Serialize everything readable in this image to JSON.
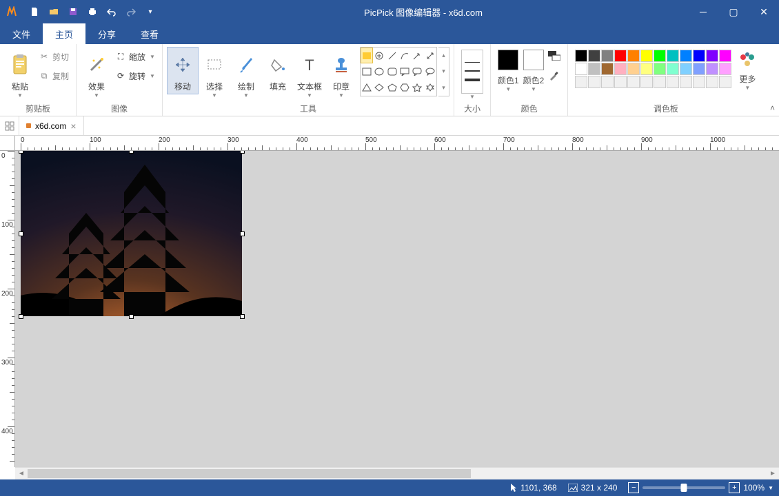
{
  "app": {
    "title": "PicPick 图像编辑器 - x6d.com"
  },
  "menu": {
    "file": "文件",
    "home": "主页",
    "share": "分享",
    "view": "查看"
  },
  "ribbon": {
    "clipboard": {
      "paste": "粘贴",
      "cut": "剪切",
      "copy": "复制",
      "label": "剪贴板"
    },
    "image": {
      "effects": "效果",
      "zoom": "缩放",
      "rotate": "旋转",
      "label": "图像"
    },
    "tools": {
      "move": "移动",
      "select": "选择",
      "draw": "绘制",
      "fill": "填充",
      "text": "文本框",
      "stamp": "印章",
      "label": "工具"
    },
    "size": {
      "label": "大小"
    },
    "colors": {
      "color1": "颜色1",
      "color2": "颜色2",
      "label": "颜色"
    },
    "palette": {
      "more": "更多",
      "label": "调色板"
    }
  },
  "palette_rows": [
    [
      "#000000",
      "#404040",
      "#808080",
      "#ff0000",
      "#ff8000",
      "#ffff00",
      "#00ff00",
      "#00c0c0",
      "#0080ff",
      "#0000ff",
      "#8000ff",
      "#ff00ff"
    ],
    [
      "#ffffff",
      "#c0c0c0",
      "#a06830",
      "#ffb0c0",
      "#ffd090",
      "#ffff80",
      "#80ff80",
      "#80ffd0",
      "#80d0ff",
      "#80a0ff",
      "#c090ff",
      "#ffa0ff"
    ],
    [
      "#f0f0f0",
      "#f0f0f0",
      "#f0f0f0",
      "#f0f0f0",
      "#f0f0f0",
      "#f0f0f0",
      "#f0f0f0",
      "#f0f0f0",
      "#f0f0f0",
      "#f0f0f0",
      "#f0f0f0",
      "#f0f0f0"
    ]
  ],
  "tabs": {
    "doc1": "x6d.com"
  },
  "status": {
    "cursor_pos": "1101, 368",
    "image_size": "321 x 240",
    "zoom": "100%"
  },
  "ruler_h": [
    "0",
    "100",
    "200",
    "300",
    "400",
    "500",
    "600",
    "700",
    "800",
    "900",
    "1000"
  ],
  "ruler_v": [
    "0",
    "100",
    "200",
    "300",
    "400"
  ]
}
